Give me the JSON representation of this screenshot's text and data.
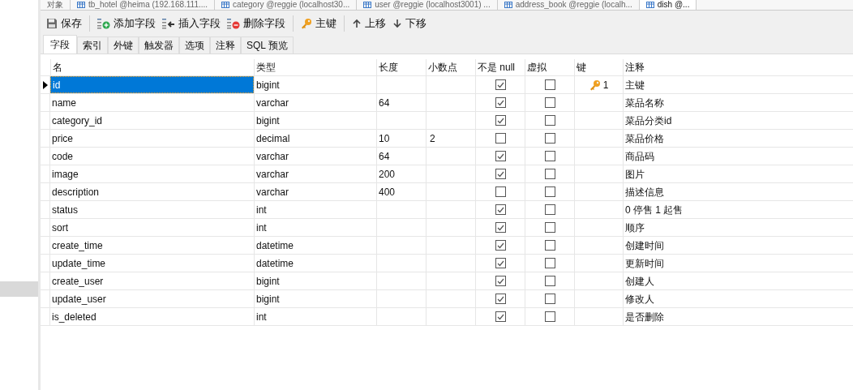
{
  "doc_tabs": [
    {
      "label": "对象",
      "selected": false
    },
    {
      "label": "tb_hotel @heima (192.168.111....",
      "selected": false
    },
    {
      "label": "category @reggie (localhost30...",
      "selected": false
    },
    {
      "label": "user @reggie (localhost3001) ...",
      "selected": false
    },
    {
      "label": "address_book @reggie (localh...",
      "selected": false
    },
    {
      "label": "dish @...",
      "selected": true
    }
  ],
  "toolbar": [
    {
      "kind": "save",
      "label": "保存"
    },
    {
      "kind": "sep"
    },
    {
      "kind": "add",
      "label": "添加字段"
    },
    {
      "kind": "insert",
      "label": "插入字段"
    },
    {
      "kind": "delete",
      "label": "删除字段"
    },
    {
      "kind": "sep"
    },
    {
      "kind": "key",
      "label": "主键"
    },
    {
      "kind": "sep"
    },
    {
      "kind": "up",
      "label": "上移"
    },
    {
      "kind": "down",
      "label": "下移"
    }
  ],
  "tabs": [
    {
      "label": "字段",
      "selected": true
    },
    {
      "label": "索引",
      "selected": false
    },
    {
      "label": "外键",
      "selected": false
    },
    {
      "label": "触发器",
      "selected": false
    },
    {
      "label": "选项",
      "selected": false
    },
    {
      "label": "注释",
      "selected": false
    },
    {
      "label": "SQL 预览",
      "selected": false
    }
  ],
  "table": {
    "columns": [
      "名",
      "类型",
      "长度",
      "小数点",
      "不是 null",
      "虚拟",
      "键",
      "注释"
    ],
    "rows": [
      {
        "name": "id",
        "type": "bigint",
        "length": "",
        "decimals": "",
        "not_null": true,
        "virtual": false,
        "key": "1",
        "comment": "主键",
        "selected": true
      },
      {
        "name": "name",
        "type": "varchar",
        "length": "64",
        "decimals": "",
        "not_null": true,
        "virtual": false,
        "comment": "菜品名称",
        "selected": false
      },
      {
        "name": "category_id",
        "type": "bigint",
        "length": "",
        "decimals": "",
        "not_null": true,
        "virtual": false,
        "comment": "菜品分类id",
        "selected": false
      },
      {
        "name": "price",
        "type": "decimal",
        "length": "10",
        "decimals": "2",
        "not_null": false,
        "virtual": false,
        "comment": "菜品价格",
        "selected": false
      },
      {
        "name": "code",
        "type": "varchar",
        "length": "64",
        "decimals": "",
        "not_null": true,
        "virtual": false,
        "comment": "商品码",
        "selected": false
      },
      {
        "name": "image",
        "type": "varchar",
        "length": "200",
        "decimals": "",
        "not_null": true,
        "virtual": false,
        "comment": "图片",
        "selected": false
      },
      {
        "name": "description",
        "type": "varchar",
        "length": "400",
        "decimals": "",
        "not_null": false,
        "virtual": false,
        "comment": "描述信息",
        "selected": false
      },
      {
        "name": "status",
        "type": "int",
        "length": "",
        "decimals": "",
        "not_null": true,
        "virtual": false,
        "comment": "0 停售 1 起售",
        "selected": false
      },
      {
        "name": "sort",
        "type": "int",
        "length": "",
        "decimals": "",
        "not_null": true,
        "virtual": false,
        "comment": "顺序",
        "selected": false
      },
      {
        "name": "create_time",
        "type": "datetime",
        "length": "",
        "decimals": "",
        "not_null": true,
        "virtual": false,
        "comment": "创建时间",
        "selected": false
      },
      {
        "name": "update_time",
        "type": "datetime",
        "length": "",
        "decimals": "",
        "not_null": true,
        "virtual": false,
        "comment": "更新时间",
        "selected": false
      },
      {
        "name": "create_user",
        "type": "bigint",
        "length": "",
        "decimals": "",
        "not_null": true,
        "virtual": false,
        "comment": "创建人",
        "selected": false
      },
      {
        "name": "update_user",
        "type": "bigint",
        "length": "",
        "decimals": "",
        "not_null": true,
        "virtual": false,
        "comment": "修改人",
        "selected": false
      },
      {
        "name": "is_deleted",
        "type": "int",
        "length": "",
        "decimals": "",
        "not_null": true,
        "virtual": false,
        "comment": "是否删除",
        "selected": false
      }
    ]
  }
}
